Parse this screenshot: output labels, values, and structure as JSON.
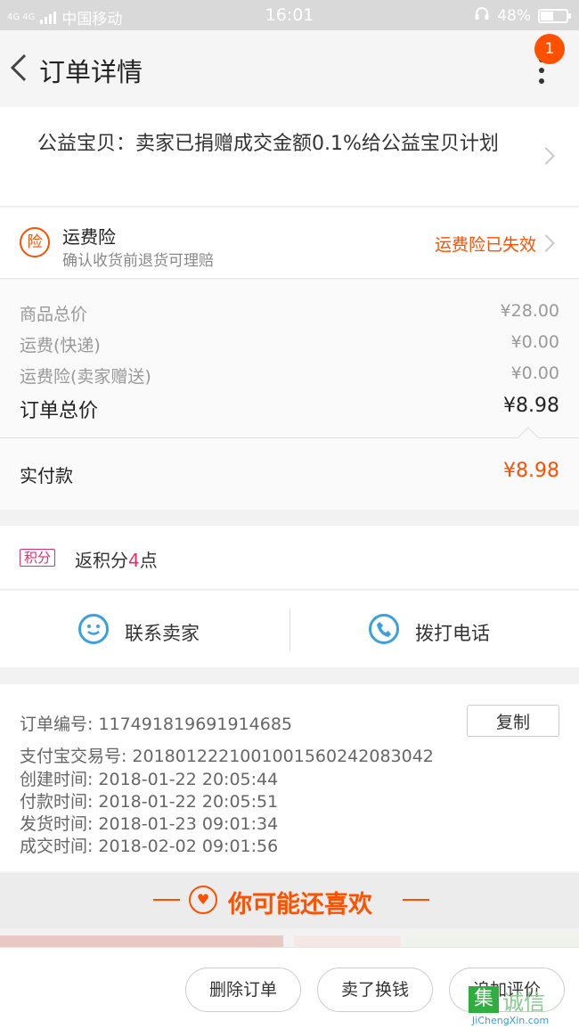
{
  "status_bar": {
    "network": "4G 4G",
    "carrier": "中国移动",
    "time": "16:01",
    "battery": "48%",
    "battery_level": 0.48
  },
  "header": {
    "title": "订单详情",
    "notification_count": "1",
    "back_icon": "chevron-left-icon",
    "more_icon": "more-vertical-icon"
  },
  "charity": {
    "text": "公益宝贝：卖家已捐赠成交金额0.1%给公益宝贝计划"
  },
  "shipping_insurance": {
    "icon_text": "险",
    "title": "运费险",
    "subtitle": "确认收货前退货可理赔",
    "status": "运费险已失效"
  },
  "price_details": {
    "rows": [
      {
        "label": "商品总价",
        "value": "¥28.00"
      },
      {
        "label": "运费(快递)",
        "value": "¥0.00"
      },
      {
        "label": "运费险(卖家赠送)",
        "value": "¥0.00"
      }
    ],
    "total_label": "订单总价",
    "total_value": "¥8.98"
  },
  "actual_payment": {
    "label": "实付款",
    "value": "¥8.98"
  },
  "points": {
    "tag": "积分",
    "text_before": "返积分",
    "number": "4",
    "text_after": "点"
  },
  "contact": {
    "seller_label": "联系卖家",
    "phone_label": "拨打电话"
  },
  "order_info": {
    "copy_label": "复制",
    "lines": [
      {
        "label": "订单编号:",
        "value": "117491819691914685"
      },
      {
        "label": "支付宝交易号:",
        "value": "2018012221001001560242083042"
      },
      {
        "label": "创建时间:",
        "value": "2018-01-22 20:05:44"
      },
      {
        "label": "付款时间:",
        "value": "2018-01-22 20:05:51"
      },
      {
        "label": "发货时间:",
        "value": "2018-01-23 09:01:34"
      },
      {
        "label": "成交时间:",
        "value": "2018-02-02 09:01:56"
      }
    ]
  },
  "recommend": {
    "title": "你可能还喜欢"
  },
  "actions": {
    "delete_label": "删除订单",
    "buy_again_label": "卖了换钱",
    "review_label": "追加评价"
  },
  "watermark": {
    "brand_box": "集",
    "brand_cn": "诚信",
    "brand_en": "JiChengXin.com"
  },
  "colors": {
    "accent": "#ff5000",
    "points_pink": "#e0306a",
    "contact_blue": "#3ba0e0"
  }
}
